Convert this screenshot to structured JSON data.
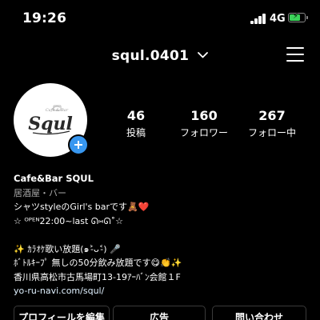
{
  "status_bar": {
    "time": "19:26",
    "network": "4G",
    "battery_level": 0.75,
    "colors": {
      "battery": "#3cd35a"
    }
  },
  "header": {
    "username": "squl.0401",
    "chevron_icon": "chevron-down-icon",
    "menu_icon": "hamburger-menu-icon"
  },
  "avatar": {
    "logo_script": "Squl",
    "logo_small": "Cafe & Bar",
    "add_icon": "plus-icon"
  },
  "stats": [
    {
      "value": "46",
      "label": "投稿"
    },
    {
      "value": "160",
      "label": "フォロワー"
    },
    {
      "value": "267",
      "label": "フォロー中"
    }
  ],
  "bio": {
    "name": "Cafe&Bar SQUL",
    "category": "居酒屋・バー",
    "lines": [
      "シャツstyleのGirl's barです🧸❤️",
      "☆ ᴼᴾᴱᴺ22:00~last ᘏ⑅ᘏ˚☆",
      "",
      "✨ ｶﾗｵｹ歌い放題(๑˃̵ᴗ˂̵) 🎤",
      "ﾎﾞﾄﾙｷｰﾌﾟ 無しの50分飲み放題です😋👏✨",
      "香川県高松市古馬場町13-19ｱｰﾊﾞﾝ会館１F"
    ],
    "link": "yo-ru-navi.com/squl/"
  },
  "buttons": {
    "edit_profile": "プロフィールを編集",
    "ads": "広告",
    "contact": "問い合わせ"
  },
  "colors": {
    "accent": "#3897f0",
    "background": "#000000",
    "secondary_text": "#a8a8a8"
  }
}
